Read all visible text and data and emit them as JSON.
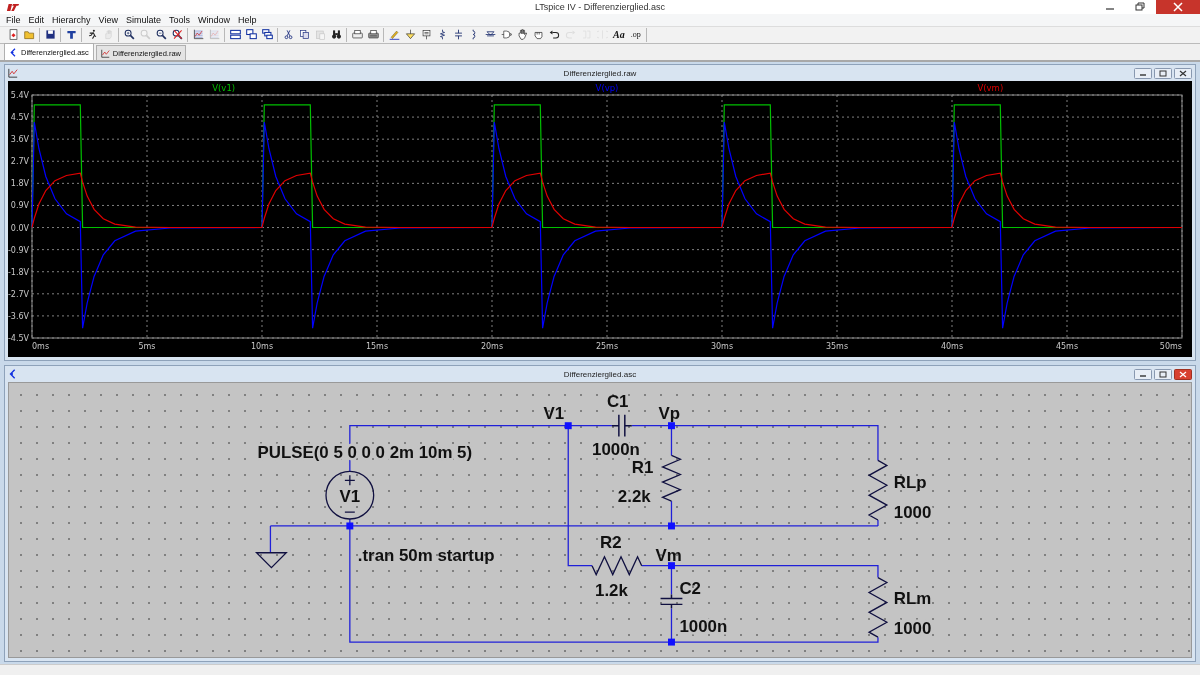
{
  "title_bar": {
    "title": "LTspice IV - Differenzierglied.asc"
  },
  "menu": [
    "File",
    "Edit",
    "Hierarchy",
    "View",
    "Simulate",
    "Tools",
    "Window",
    "Help"
  ],
  "toolbar": [
    {
      "kind": "new",
      "disabled": false
    },
    {
      "kind": "open",
      "disabled": false
    },
    {
      "kind": "separator"
    },
    {
      "kind": "save",
      "disabled": false
    },
    {
      "kind": "separator"
    },
    {
      "kind": "control",
      "disabled": false
    },
    {
      "kind": "separator"
    },
    {
      "kind": "run",
      "disabled": false
    },
    {
      "kind": "halt",
      "disabled": true
    },
    {
      "kind": "separator"
    },
    {
      "kind": "zoomin",
      "disabled": false
    },
    {
      "kind": "zoompan",
      "disabled": true
    },
    {
      "kind": "zoomout",
      "disabled": false
    },
    {
      "kind": "zoomcancel",
      "disabled": false
    },
    {
      "kind": "separator"
    },
    {
      "kind": "plot",
      "disabled": false
    },
    {
      "kind": "plot",
      "disabled": true
    },
    {
      "kind": "separator"
    },
    {
      "kind": "tileh",
      "disabled": false
    },
    {
      "kind": "cascade",
      "disabled": false
    },
    {
      "kind": "tilev",
      "disabled": false
    },
    {
      "kind": "separator"
    },
    {
      "kind": "cut",
      "disabled": false
    },
    {
      "kind": "copy",
      "disabled": false
    },
    {
      "kind": "paste",
      "disabled": true
    },
    {
      "kind": "find",
      "disabled": false
    },
    {
      "kind": "separator"
    },
    {
      "kind": "printsetup",
      "disabled": false
    },
    {
      "kind": "print",
      "disabled": false
    },
    {
      "kind": "separator"
    },
    {
      "kind": "wire",
      "disabled": false
    },
    {
      "kind": "ground",
      "disabled": false
    },
    {
      "kind": "label",
      "disabled": false
    },
    {
      "kind": "resistor",
      "disabled": false
    },
    {
      "kind": "capacitor",
      "disabled": false
    },
    {
      "kind": "inductor",
      "disabled": false
    },
    {
      "kind": "diode",
      "disabled": false
    },
    {
      "kind": "component",
      "disabled": false
    },
    {
      "kind": "move",
      "disabled": false
    },
    {
      "kind": "drag",
      "disabled": false
    },
    {
      "kind": "undo",
      "disabled": false
    },
    {
      "kind": "redo",
      "disabled": true
    },
    {
      "kind": "rotate",
      "disabled": true
    },
    {
      "kind": "mirror",
      "disabled": true
    },
    {
      "kind": "text",
      "label": "Aa",
      "disabled": false
    },
    {
      "kind": "directive",
      "label": ".op",
      "disabled": false
    },
    {
      "kind": "separator"
    }
  ],
  "tabs": [
    {
      "label": "Differenzierglied.asc",
      "kind": "schematic",
      "selected": true
    },
    {
      "label": "Differenzierglied.raw",
      "kind": "waveform",
      "selected": false
    }
  ],
  "plot_window": {
    "title": "Differenzierglied.raw",
    "chart_data": {
      "type": "line",
      "grid": true,
      "xlim": [
        0,
        50
      ],
      "ylim": [
        -4.5,
        5.4
      ],
      "x": [
        0,
        0.1,
        0.3,
        0.6,
        1,
        1.5,
        2.1,
        2.2,
        2.4,
        2.7,
        3.1,
        3.6,
        4.5,
        6,
        10,
        10.1,
        10.3,
        10.6,
        11,
        11.5,
        12.1,
        12.2,
        12.4,
        12.7,
        13.1,
        13.6,
        14.5,
        16,
        20,
        20.1,
        20.3,
        20.6,
        21,
        21.5,
        22.1,
        22.2,
        22.4,
        22.7,
        23.1,
        23.6,
        24.5,
        26,
        30,
        30.1,
        30.3,
        30.6,
        31,
        31.5,
        32.1,
        32.2,
        32.4,
        32.7,
        33.1,
        33.6,
        34.5,
        36,
        40,
        40.1,
        40.3,
        40.6,
        41,
        41.5,
        42.1,
        42.2,
        42.4,
        42.7,
        43.1,
        43.6,
        44.5,
        46,
        50
      ],
      "series": [
        {
          "name": "V(v1)",
          "color": "#00c000",
          "values": [
            0,
            5,
            5,
            5,
            5,
            5,
            5,
            0,
            0,
            0,
            0,
            0,
            0,
            0,
            0,
            5,
            5,
            5,
            5,
            5,
            5,
            0,
            0,
            0,
            0,
            0,
            0,
            0,
            0,
            5,
            5,
            5,
            5,
            5,
            5,
            0,
            0,
            0,
            0,
            0,
            0,
            0,
            0,
            5,
            5,
            5,
            5,
            5,
            5,
            0,
            0,
            0,
            0,
            0,
            0,
            0,
            0,
            5,
            5,
            5,
            5,
            5,
            5,
            0,
            0,
            0,
            0,
            0,
            0,
            0,
            0
          ]
        },
        {
          "name": "V(vp)",
          "color": "#0000ff",
          "values": [
            0,
            4.3,
            3.22,
            2.08,
            1.17,
            0.56,
            0.24,
            -4.1,
            -3.07,
            -1.99,
            -1.11,
            -0.54,
            -0.15,
            -0.02,
            0,
            4.3,
            3.22,
            2.08,
            1.17,
            0.56,
            0.24,
            -4.1,
            -3.07,
            -1.99,
            -1.11,
            -0.54,
            -0.15,
            -0.02,
            0,
            4.3,
            3.22,
            2.08,
            1.17,
            0.56,
            0.24,
            -4.1,
            -3.07,
            -1.99,
            -1.11,
            -0.54,
            -0.15,
            -0.02,
            0,
            4.3,
            3.22,
            2.08,
            1.17,
            0.56,
            0.24,
            -4.1,
            -3.07,
            -1.99,
            -1.11,
            -0.54,
            -0.15,
            -0.02,
            0,
            4.3,
            3.22,
            2.08,
            1.17,
            0.56,
            0.24,
            -4.1,
            -3.07,
            -1.99,
            -1.11,
            -0.54,
            -0.15,
            -0.02,
            0
          ]
        },
        {
          "name": "V(vm)",
          "color": "#e00000",
          "values": [
            0,
            0.38,
            0.96,
            1.51,
            1.91,
            2.12,
            2.22,
            1.85,
            1.28,
            0.74,
            0.36,
            0.14,
            0.02,
            0,
            0,
            0.38,
            0.96,
            1.51,
            1.91,
            2.12,
            2.22,
            1.85,
            1.28,
            0.74,
            0.36,
            0.14,
            0.02,
            0,
            0,
            0.38,
            0.96,
            1.51,
            1.91,
            2.12,
            2.22,
            1.85,
            1.28,
            0.74,
            0.36,
            0.14,
            0.02,
            0,
            0,
            0.38,
            0.96,
            1.51,
            1.91,
            2.12,
            2.22,
            1.85,
            1.28,
            0.74,
            0.36,
            0.14,
            0.02,
            0,
            0,
            0.38,
            0.96,
            1.51,
            1.91,
            2.12,
            2.22,
            1.85,
            1.28,
            0.74,
            0.36,
            0.14,
            0.02,
            0,
            0
          ]
        }
      ],
      "yticks": [
        {
          "value": 5.4,
          "label": "5.4V"
        },
        {
          "value": 4.5,
          "label": "4.5V"
        },
        {
          "value": 3.6,
          "label": "3.6V"
        },
        {
          "value": 2.7,
          "label": "2.7V"
        },
        {
          "value": 1.8,
          "label": "1.8V"
        },
        {
          "value": 0.9,
          "label": "0.9V"
        },
        {
          "value": 0,
          "label": "0.0V"
        },
        {
          "value": -0.9,
          "label": "-0.9V"
        },
        {
          "value": -1.8,
          "label": "-1.8V"
        },
        {
          "value": -2.7,
          "label": "-2.7V"
        },
        {
          "value": -3.6,
          "label": "-3.6V"
        },
        {
          "value": -4.5,
          "label": "-4.5V"
        }
      ],
      "xticks": [
        {
          "value": 0,
          "label": "0ms"
        },
        {
          "value": 5,
          "label": "5ms"
        },
        {
          "value": 10,
          "label": "10ms"
        },
        {
          "value": 15,
          "label": "15ms"
        },
        {
          "value": 20,
          "label": "20ms"
        },
        {
          "value": 25,
          "label": "25ms"
        },
        {
          "value": 30,
          "label": "30ms"
        },
        {
          "value": 35,
          "label": "35ms"
        },
        {
          "value": 40,
          "label": "40ms"
        },
        {
          "value": 45,
          "label": "45ms"
        },
        {
          "value": 50,
          "label": "50ms"
        }
      ]
    }
  },
  "schematic_window": {
    "title": "Differenzierglied.asc",
    "texts": [
      {
        "kind": "ref",
        "text": "C1"
      },
      {
        "kind": "net",
        "text": "V1"
      },
      {
        "kind": "net",
        "text": "Vp"
      },
      {
        "kind": "value",
        "text": "1000n"
      },
      {
        "kind": "value",
        "text": "PULSE(0 5 0 0 0 2m 10m 5)"
      },
      {
        "kind": "ref",
        "text": "R1"
      },
      {
        "kind": "value",
        "text": "2.2k"
      },
      {
        "kind": "ref",
        "text": "RLp"
      },
      {
        "kind": "source_ref",
        "text": "V1"
      },
      {
        "kind": "value",
        "text": "1000"
      },
      {
        "kind": "ref",
        "text": "R2"
      },
      {
        "kind": "directive",
        "text": ".tran 50m startup"
      },
      {
        "kind": "net",
        "text": "Vm"
      },
      {
        "kind": "ref",
        "text": "C2"
      },
      {
        "kind": "value",
        "text": "1.2k"
      },
      {
        "kind": "ref",
        "text": "RLm"
      },
      {
        "kind": "value",
        "text": "1000n"
      },
      {
        "kind": "value",
        "text": "1000"
      }
    ]
  }
}
